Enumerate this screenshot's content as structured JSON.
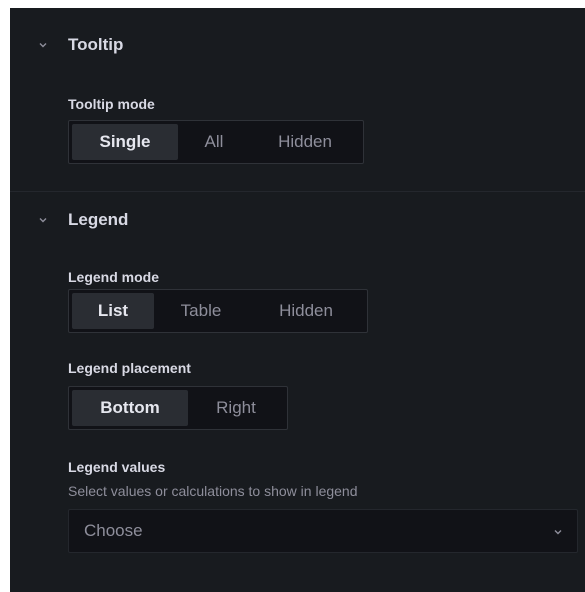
{
  "tooltip": {
    "title": "Tooltip",
    "mode_label": "Tooltip mode",
    "options": [
      "Single",
      "All",
      "Hidden"
    ],
    "selected": "Single"
  },
  "legend": {
    "title": "Legend",
    "mode_label": "Legend mode",
    "mode_options": [
      "List",
      "Table",
      "Hidden"
    ],
    "mode_selected": "List",
    "placement_label": "Legend placement",
    "placement_options": [
      "Bottom",
      "Right"
    ],
    "placement_selected": "Bottom",
    "values_label": "Legend values",
    "values_description": "Select values or calculations to show in legend",
    "values_placeholder": "Choose"
  },
  "colors": {
    "panel_background": "#181b1f",
    "input_background": "#111217",
    "active_option_background": "#2a2d33",
    "primary_text": "#d8d9e4",
    "secondary_text": "#8e8e9b"
  },
  "icons": {
    "section_toggle": "chevron-down-icon",
    "select_caret": "caret-down-icon"
  }
}
